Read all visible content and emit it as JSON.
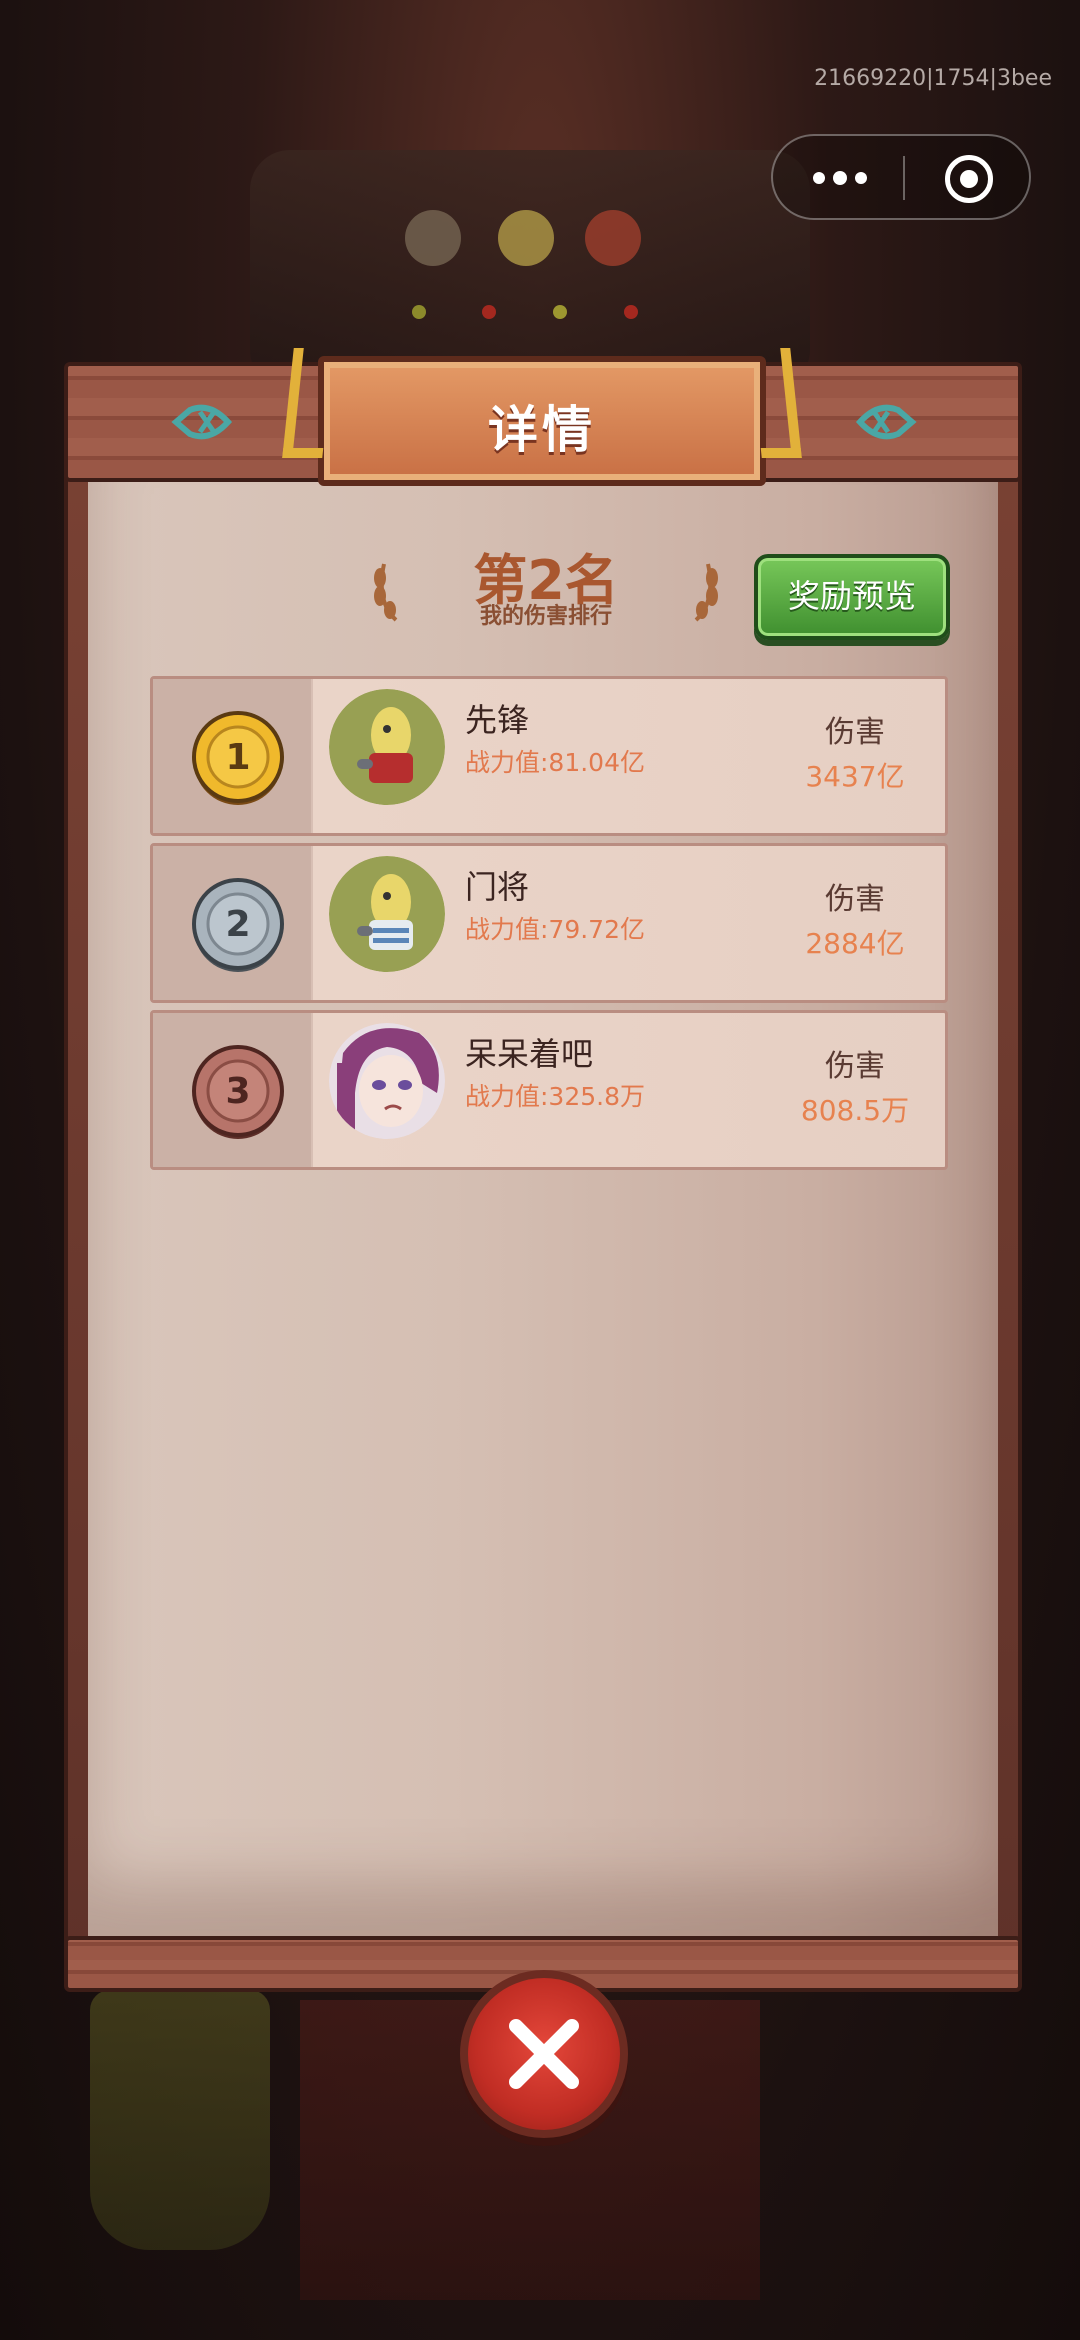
{
  "status": {
    "build_id": "21669220|1754|3bee"
  },
  "capsule": {
    "more_icon": "more-dots-icon",
    "close_icon": "target-icon"
  },
  "panel": {
    "title": "详情"
  },
  "rank": {
    "title": "第2名",
    "subtitle": "我的伤害排行"
  },
  "reward_button": {
    "label": "奖励预览"
  },
  "leaderboard": [
    {
      "rank": "1",
      "name": "先锋",
      "power": "战力值:81.04亿",
      "damage_label": "伤害",
      "damage": "3437亿",
      "medal_color": "#f0b92c"
    },
    {
      "rank": "2",
      "name": "门将",
      "power": "战力值:79.72亿",
      "damage_label": "伤害",
      "damage": "2884亿",
      "medal_color": "#a9b4bd"
    },
    {
      "rank": "3",
      "name": "呆呆着吧",
      "power": "战力值:325.8万",
      "damage_label": "伤害",
      "damage": "808.5万",
      "medal_color": "#b7746a"
    }
  ],
  "colors": {
    "accent_orange": "#e7824f",
    "title_brown": "#a9572f",
    "button_green": "#5aa844",
    "close_red": "#d23a2e"
  }
}
